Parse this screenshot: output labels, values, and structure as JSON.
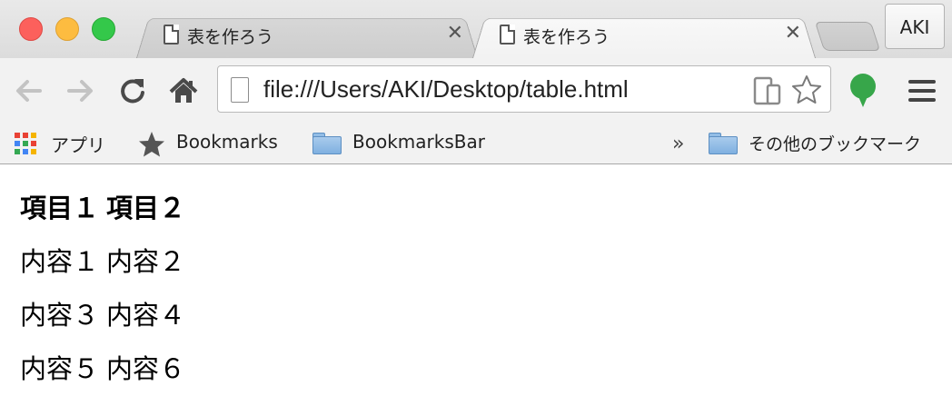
{
  "window": {
    "tabs": [
      {
        "title": "表を作ろう",
        "close": "✕"
      },
      {
        "title": "表を作ろう",
        "close": "✕"
      }
    ],
    "profile": "AKI"
  },
  "toolbar": {
    "url": "file:///Users/AKI/Desktop/table.html"
  },
  "bookmarks": {
    "apps": "アプリ",
    "bookmarks": "Bookmarks",
    "bookmarks_bar": "BookmarksBar",
    "overflow": "»",
    "other": "その他のブックマーク"
  },
  "table": {
    "headers": [
      "項目１",
      "項目２"
    ],
    "rows": [
      [
        "内容１",
        "内容２"
      ],
      [
        "内容３",
        "内容４"
      ],
      [
        "内容５",
        "内容６"
      ]
    ]
  },
  "colors": {
    "close_red": "#fc605c",
    "minimize_yellow": "#fdbc40",
    "zoom_green": "#34c84a",
    "extension_green": "#37a64a"
  }
}
